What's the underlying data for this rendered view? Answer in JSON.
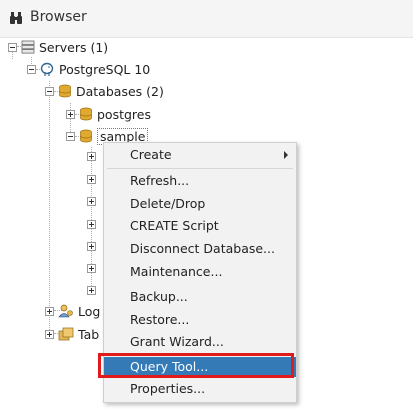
{
  "header": {
    "title": "Browser"
  },
  "tree": {
    "servers": "Servers (1)",
    "server": "PostgreSQL 10",
    "databases": "Databases (2)",
    "db1": "postgres",
    "db2": "sample",
    "login_partial": "Log",
    "tablespaces_partial": "Tab"
  },
  "context_menu": {
    "items": [
      "Create",
      "Refresh...",
      "Delete/Drop",
      "CREATE Script",
      "Disconnect Database...",
      "Maintenance...",
      "Backup...",
      "Restore...",
      "Grant Wizard...",
      "Query Tool...",
      "Properties..."
    ],
    "highlighted": "Query Tool..."
  },
  "colors": {
    "highlight": "#337ab7",
    "annotation": "#e11a1a"
  }
}
